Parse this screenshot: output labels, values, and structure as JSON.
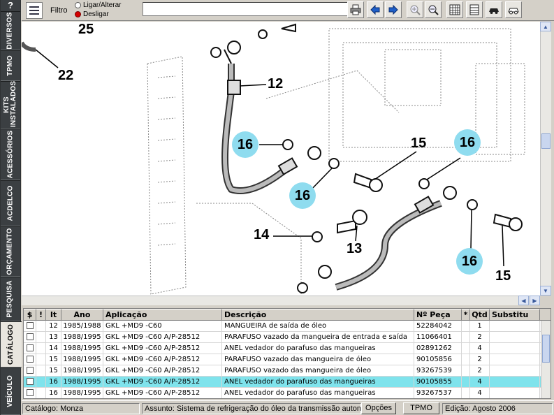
{
  "side_tabs": [
    {
      "label": "?"
    },
    {
      "label": "DIVERSOS"
    },
    {
      "label": "TPMO"
    },
    {
      "label": "KITS INSTALADOS"
    },
    {
      "label": "ACESSÓRIOS"
    },
    {
      "label": "ACDELCO"
    },
    {
      "label": "ORÇAMENTO"
    },
    {
      "label": "PESQUISA"
    },
    {
      "label": "CATÁLOGO"
    },
    {
      "label": "VEÍCULO"
    }
  ],
  "toolbar": {
    "filter_label": "Filtro",
    "radio_on_off": "Ligar/Alterar",
    "radio_off": "Desligar",
    "filter_value": "",
    "icons": [
      "print-icon",
      "back-arrow-icon",
      "forward-arrow-icon",
      "zoom-in-icon",
      "zoom-out-icon",
      "grid-icon",
      "list-icon",
      "car-icon",
      "car-outline-icon"
    ]
  },
  "diagram": {
    "callouts": [
      "25",
      "22",
      "12",
      "16",
      "15",
      "16",
      "16",
      "14",
      "13",
      "16",
      "15"
    ],
    "highlight_color": "#8fdcef"
  },
  "table": {
    "headers": [
      "$",
      "!",
      "It",
      "Ano",
      "Aplicação",
      "Descrição",
      "Nº Peça",
      "*",
      "Qtd",
      "Substitu"
    ],
    "rows": [
      {
        "it": "12",
        "ano": "1985/1988",
        "aplicacao": "GKL +MD9 -C60",
        "descricao": "MANGUEIRA de saída de óleo",
        "peca": "52284042",
        "star": "",
        "qtd": "1",
        "subst": ""
      },
      {
        "it": "13",
        "ano": "1988/1995",
        "aplicacao": "GKL +MD9 -C60 A/P-28512",
        "descricao": "PARAFUSO vazado da mangueira de entrada e saída",
        "peca": "11066401",
        "star": "",
        "qtd": "2",
        "subst": ""
      },
      {
        "it": "14",
        "ano": "1988/1995",
        "aplicacao": "GKL +MD9 -C60 A/P-28512",
        "descricao": "ANEL vedador do parafuso das mangueiras",
        "peca": "02891262",
        "star": "",
        "qtd": "4",
        "subst": ""
      },
      {
        "it": "15",
        "ano": "1988/1995",
        "aplicacao": "GKL +MD9 -C60 A/P-28512",
        "descricao": "PARAFUSO vazado das mangueira de óleo",
        "peca": "90105856",
        "star": "",
        "qtd": "2",
        "subst": ""
      },
      {
        "it": "15",
        "ano": "1988/1995",
        "aplicacao": "GKL +MD9 -C60 A/P-28512",
        "descricao": "PARAFUSO vazado das mangueira de óleo",
        "peca": "93267539",
        "star": "",
        "qtd": "2",
        "subst": ""
      },
      {
        "it": "16",
        "ano": "1988/1995",
        "aplicacao": "GKL +MD9 -C60 A/P-28512",
        "descricao": "ANEL vedador do parafuso das mangueiras",
        "peca": "90105855",
        "star": "",
        "qtd": "4",
        "subst": ""
      },
      {
        "it": "16",
        "ano": "1988/1995",
        "aplicacao": "GKL +MD9 -C60 A/P-28512",
        "descricao": "ANEL vedador do parafuso das mangueiras",
        "peca": "93267537",
        "star": "",
        "qtd": "4",
        "subst": ""
      }
    ],
    "selected_row_color": "#7fe3ec"
  },
  "status": {
    "catalogo": "Catálogo: Monza",
    "assunto": "Assunto: Sistema de refrigeração do óleo da transmissão automá",
    "opcoes_button": "Opções",
    "tpmo_button": "TPMO",
    "edicao": "Edição: Agosto 2006"
  }
}
